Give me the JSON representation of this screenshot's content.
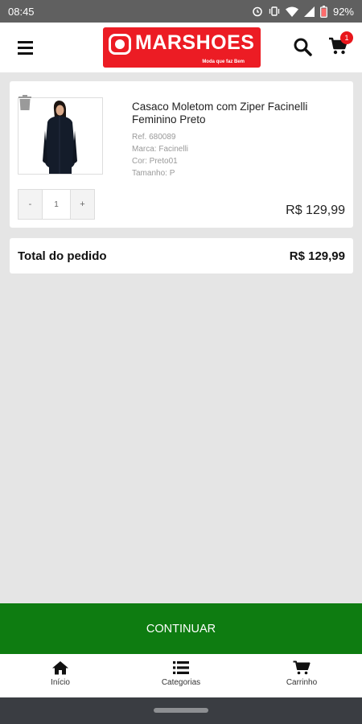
{
  "status": {
    "time": "08:45",
    "battery": "92%"
  },
  "header": {
    "logo_text": "MARSHOES",
    "logo_tagline": "Moda que faz Bem",
    "cart_count": "1"
  },
  "cart_item": {
    "name": "Casaco Moletom com Ziper Facinelli Feminino Preto",
    "ref": "Ref. 680089",
    "brand": "Marca: Facinelli",
    "color": "Cor: Preto01",
    "size": "Tamanho: P",
    "quantity": "1",
    "decrement_label": "-",
    "increment_label": "+",
    "price": "R$ 129,99"
  },
  "total": {
    "label": "Total do pedido",
    "value": "R$ 129,99"
  },
  "continue_label": "CONTINUAR",
  "bottom_nav": [
    {
      "label": "Início",
      "icon": "home-icon"
    },
    {
      "label": "Categorias",
      "icon": "list-icon"
    },
    {
      "label": "Carrinho",
      "icon": "cart-icon"
    }
  ],
  "colors": {
    "brand": "#ec1c24",
    "continue": "#0e7c11",
    "badge": "#e8161b"
  }
}
